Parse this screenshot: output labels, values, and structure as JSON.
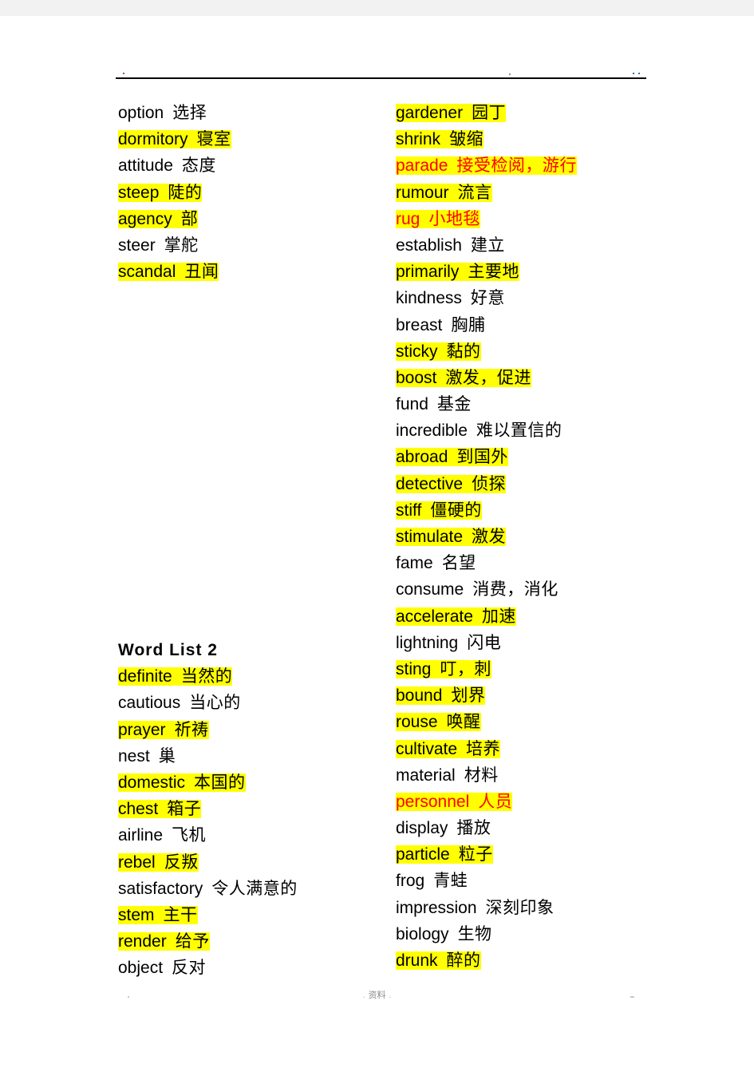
{
  "document": {
    "footer_text": "资料",
    "highlight_color": "#ffff00",
    "red_text_color": "#ff0000",
    "body_text_color": "#000000",
    "page_background": "#ffffff",
    "canvas_background": "#f2f2f2"
  },
  "left_column_1": {
    "entries": [
      {
        "word": "option",
        "cn": "选择",
        "highlight": false,
        "red": false
      },
      {
        "word": "dormitory",
        "cn": "寝室",
        "highlight": true,
        "red": false
      },
      {
        "word": "attitude",
        "cn": "态度",
        "highlight": false,
        "red": false
      },
      {
        "word": "steep",
        "cn": "陡的",
        "highlight": true,
        "red": false
      },
      {
        "word": "agency",
        "cn": "部",
        "highlight": true,
        "red": false
      },
      {
        "word": "steer",
        "cn": "掌舵",
        "highlight": false,
        "red": false
      },
      {
        "word": "scandal",
        "cn": "丑闻",
        "highlight": true,
        "red": false
      }
    ]
  },
  "left_column_2": {
    "heading": "Word List 2",
    "entries": [
      {
        "word": "definite",
        "cn": "当然的",
        "highlight": true,
        "red": false
      },
      {
        "word": "cautious",
        "cn": "当心的",
        "highlight": false,
        "red": false
      },
      {
        "word": "prayer",
        "cn": "祈祷",
        "highlight": true,
        "red": false
      },
      {
        "word": "nest",
        "cn": "巢",
        "highlight": false,
        "red": false
      },
      {
        "word": "domestic",
        "cn": "本国的",
        "highlight": true,
        "red": false
      },
      {
        "word": "chest",
        "cn": "箱子",
        "highlight": true,
        "red": false
      },
      {
        "word": "airline",
        "cn": "飞机",
        "highlight": false,
        "red": false
      },
      {
        "word": "rebel",
        "cn": "反叛",
        "highlight": true,
        "red": false
      },
      {
        "word": "satisfactory",
        "cn": "令人满意的",
        "highlight": false,
        "red": false
      },
      {
        "word": "stem",
        "cn": "主干",
        "highlight": true,
        "red": false
      },
      {
        "word": "render",
        "cn": "给予",
        "highlight": true,
        "red": false
      },
      {
        "word": "object",
        "cn": "反对",
        "highlight": false,
        "red": false
      }
    ]
  },
  "right_column": {
    "entries": [
      {
        "word": "gardener",
        "cn": "园丁",
        "highlight": true,
        "red": false
      },
      {
        "word": "shrink",
        "cn": "皱缩",
        "highlight": true,
        "red": false
      },
      {
        "word": "parade",
        "cn": "接受检阅，游行",
        "highlight": true,
        "red": true
      },
      {
        "word": "rumour",
        "cn": "流言",
        "highlight": true,
        "red": false
      },
      {
        "word": "rug",
        "cn": "小地毯",
        "highlight": true,
        "red": true
      },
      {
        "word": "establish",
        "cn": "建立",
        "highlight": false,
        "red": false
      },
      {
        "word": "primarily",
        "cn": "主要地",
        "highlight": true,
        "red": false
      },
      {
        "word": "kindness",
        "cn": "好意",
        "highlight": false,
        "red": false
      },
      {
        "word": "breast",
        "cn": "胸脯",
        "highlight": false,
        "red": false
      },
      {
        "word": "sticky",
        "cn": "黏的",
        "highlight": true,
        "red": false
      },
      {
        "word": "boost",
        "cn": "激发，促进",
        "highlight": true,
        "red": false
      },
      {
        "word": "fund",
        "cn": "基金",
        "highlight": false,
        "red": false
      },
      {
        "word": "incredible",
        "cn": "难以置信的",
        "highlight": false,
        "red": false
      },
      {
        "word": "abroad",
        "cn": "到国外",
        "highlight": true,
        "red": false
      },
      {
        "word": "detective",
        "cn": "侦探",
        "highlight": true,
        "red": false
      },
      {
        "word": "stiff",
        "cn": "僵硬的",
        "highlight": true,
        "red": false
      },
      {
        "word": "stimulate",
        "cn": "激发",
        "highlight": true,
        "red": false
      },
      {
        "word": "fame",
        "cn": "名望",
        "highlight": false,
        "red": false
      },
      {
        "word": "consume",
        "cn": "消费，消化",
        "highlight": false,
        "red": false
      },
      {
        "word": "accelerate",
        "cn": "加速",
        "highlight": true,
        "red": false
      },
      {
        "word": "lightning",
        "cn": "闪电",
        "highlight": false,
        "red": false
      },
      {
        "word": "sting",
        "cn": "叮，刺",
        "highlight": true,
        "red": false
      },
      {
        "word": "bound",
        "cn": "划界",
        "highlight": true,
        "red": false
      },
      {
        "word": "rouse",
        "cn": "唤醒",
        "highlight": true,
        "red": false
      },
      {
        "word": "cultivate",
        "cn": "培养",
        "highlight": true,
        "red": false
      },
      {
        "word": "material",
        "cn": "材料",
        "highlight": false,
        "red": false
      },
      {
        "word": "personnel",
        "cn": "人员",
        "highlight": true,
        "red": true
      },
      {
        "word": "display",
        "cn": "播放",
        "highlight": false,
        "red": false
      },
      {
        "word": "particle",
        "cn": "粒子",
        "highlight": true,
        "red": false
      },
      {
        "word": "frog",
        "cn": "青蛙",
        "highlight": false,
        "red": false
      },
      {
        "word": "impression",
        "cn": "深刻印象",
        "highlight": false,
        "red": false
      },
      {
        "word": "biology",
        "cn": "生物",
        "highlight": false,
        "red": false
      },
      {
        "word": "drunk",
        "cn": "醉的",
        "highlight": true,
        "red": false
      }
    ]
  }
}
